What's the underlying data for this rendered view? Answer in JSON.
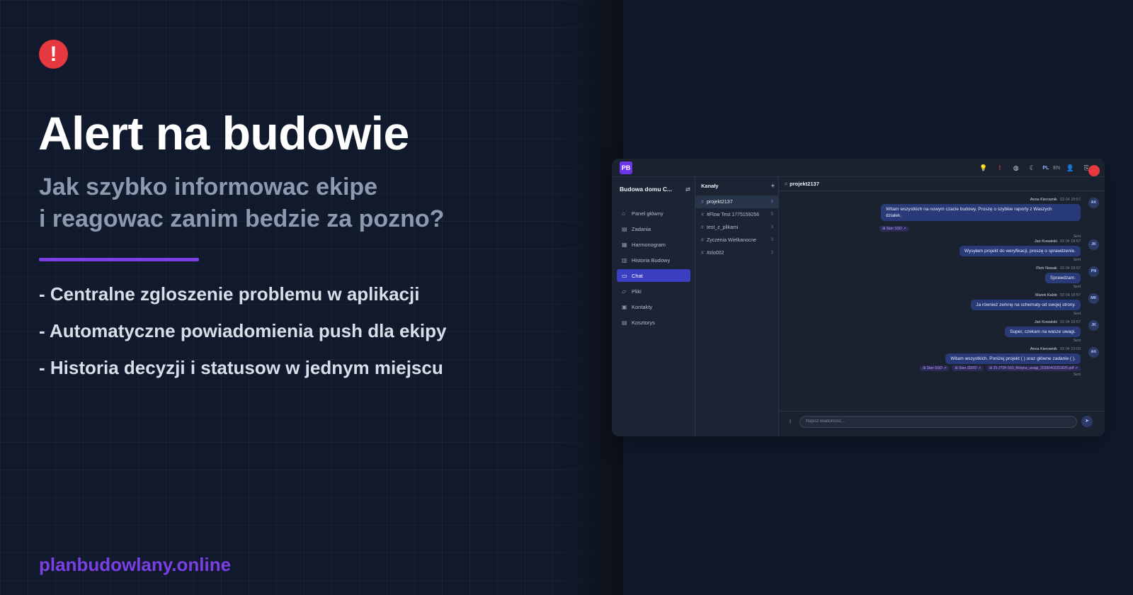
{
  "promo": {
    "title": "Alert na budowie",
    "subtitle_line1": "Jak szybko informowac ekipe",
    "subtitle_line2": "i reagowac zanim bedzie za pozno?",
    "bullets": [
      "- Centralne zgloszenie problemu w aplikacji",
      "- Automatyczne powiadomienia push dla ekipy",
      "- Historia decyzji i statusow w jednym miejscu"
    ],
    "website": "planbudowlany.online",
    "accent_color": "#7b3fe4",
    "alert_color": "#e5383f",
    "alert_icon": "!"
  },
  "app": {
    "logo": "PB",
    "topbar": {
      "lang_pl": "PL",
      "lang_en": "EN"
    },
    "sidebar": {
      "project_name": "Budowa domu C...",
      "items": [
        {
          "label": "Panel główny",
          "icon": "home-icon"
        },
        {
          "label": "Zadania",
          "icon": "clipboard-icon"
        },
        {
          "label": "Harmonogram",
          "icon": "calendar-icon"
        },
        {
          "label": "Historia Budowy",
          "icon": "book-icon"
        },
        {
          "label": "Chat",
          "icon": "chat-icon",
          "active": true
        },
        {
          "label": "Pliki",
          "icon": "folder-icon"
        },
        {
          "label": "Kontakty",
          "icon": "contact-icon"
        },
        {
          "label": "Kosztorys",
          "icon": "receipt-icon"
        }
      ]
    },
    "channels": {
      "header": "Kanały",
      "items": [
        {
          "name": "projekt2137",
          "count": "8"
        },
        {
          "name": "#Flow Test 1775159256",
          "count": "5"
        },
        {
          "name": "test_z_plikami",
          "count": "3"
        },
        {
          "name": "Zyczenia Wielkanocne",
          "count": "3"
        },
        {
          "name": "#zlo002",
          "count": "3"
        }
      ]
    },
    "chat": {
      "channel": "projekt2137",
      "messages": [
        {
          "author": "Anna Kierownik",
          "time": "02.04 18:57",
          "initials": "AK",
          "text_line1": "Witam wszystkich na nowym czacie budowy. Proszę o szybkie raporty z Waszych",
          "text_line2": "działek.",
          "tags": [
            "⊞ Stan SSO ↗"
          ],
          "status": "Sent"
        },
        {
          "author": "Jan Kowalski",
          "time": "02.04 18:57",
          "initials": "JK",
          "text": "Wysyłam projekt do weryfikacji, proszę o sprawdzenie.",
          "status": "Sent"
        },
        {
          "author": "Piotr Nowak",
          "time": "02.04 18:57",
          "initials": "PN",
          "text": "Sprawdzam.",
          "status": "Sent"
        },
        {
          "author": "Marek Kable",
          "time": "02.04 18:57",
          "initials": "MK",
          "text": "Ja również zerknę na schematy od swojej strony.",
          "status": "Sent"
        },
        {
          "author": "Jan Kowalski",
          "time": "02.04 18:57",
          "initials": "JK",
          "text": "Super, czekam na wasze uwagi.",
          "status": "Sent"
        },
        {
          "author": "Anna Kierownik",
          "time": "02.04 23:03",
          "initials": "AK",
          "text": "Witam wszystkich. Poniżej projekt ( ) oraz główne zadanie ( ).",
          "tags": [
            "⊞ Stan SSO ↗",
            "⊞ Stan ZERO ↗",
            "⊞ 25-3T0F-560_Motyka_uwagi_20260402203625.pdf ↗"
          ],
          "status": "Sent"
        }
      ],
      "composer_placeholder": "Napisz wiadomość..."
    }
  }
}
